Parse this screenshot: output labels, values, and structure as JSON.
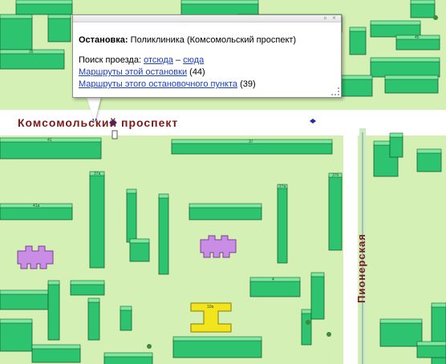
{
  "map": {
    "streets": {
      "komsomolsky": "Комсомольский проспект",
      "pionerskaya": "Пионерская"
    },
    "colors": {
      "background": "#d4f0b4",
      "road": "#ffffff",
      "building": "#2ec36e",
      "building_top": "#7ee89f",
      "school": "#c98de6",
      "highlight": "#f2e51e",
      "stop_marker": "#1d2fa8"
    },
    "building_labels": [
      "38",
      "45",
      "35",
      "37",
      "41",
      "41a",
      "37a",
      "39a",
      "27a",
      "33a",
      "21",
      "41б",
      "37б",
      "4",
      "6",
      "10а"
    ],
    "stop_markers": [
      "stop-main",
      "stop-east"
    ]
  },
  "popup": {
    "stop_label": "Остановка:",
    "stop_name": "Поликлиника (Комсомольский проспект)",
    "search_label": "Поиск проезда:",
    "from_here": "отсюда",
    "dash": "–",
    "to_here": "сюда",
    "routes_stop_link": "Маршруты этой остановки",
    "routes_stop_count": "(44)",
    "routes_point_link": "Маршруты этого остановочного пункта",
    "routes_point_count": "(39)",
    "controls": [
      "minimize-icon",
      "close-icon"
    ]
  }
}
